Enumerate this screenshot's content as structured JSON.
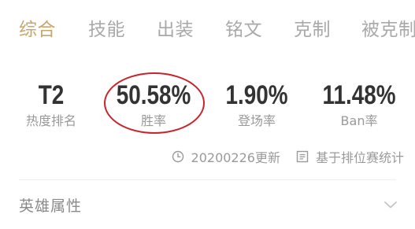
{
  "tabs": [
    {
      "label": "综合",
      "active": true
    },
    {
      "label": "技能",
      "active": false
    },
    {
      "label": "出装",
      "active": false
    },
    {
      "label": "铭文",
      "active": false
    },
    {
      "label": "克制",
      "active": false
    },
    {
      "label": "被克制",
      "active": false
    }
  ],
  "stats": [
    {
      "value": "T2",
      "label": "热度排名"
    },
    {
      "value": "50.58%",
      "label": "胜率"
    },
    {
      "value": "1.90%",
      "label": "登场率"
    },
    {
      "value": "11.48%",
      "label": "Ban率"
    }
  ],
  "meta": {
    "update_text": "20200226更新",
    "update_icon": "clock-icon",
    "source_text": "基于排位赛统计",
    "source_icon": "list-icon"
  },
  "section": {
    "title": "英雄属性",
    "icon": "chevron-down-icon"
  },
  "colors": {
    "accent": "#c9a66a",
    "tab_inactive": "#a9a9a9",
    "value_text": "#333333",
    "label_text": "#9a9a9a",
    "annotation_circle": "#c8242b"
  }
}
